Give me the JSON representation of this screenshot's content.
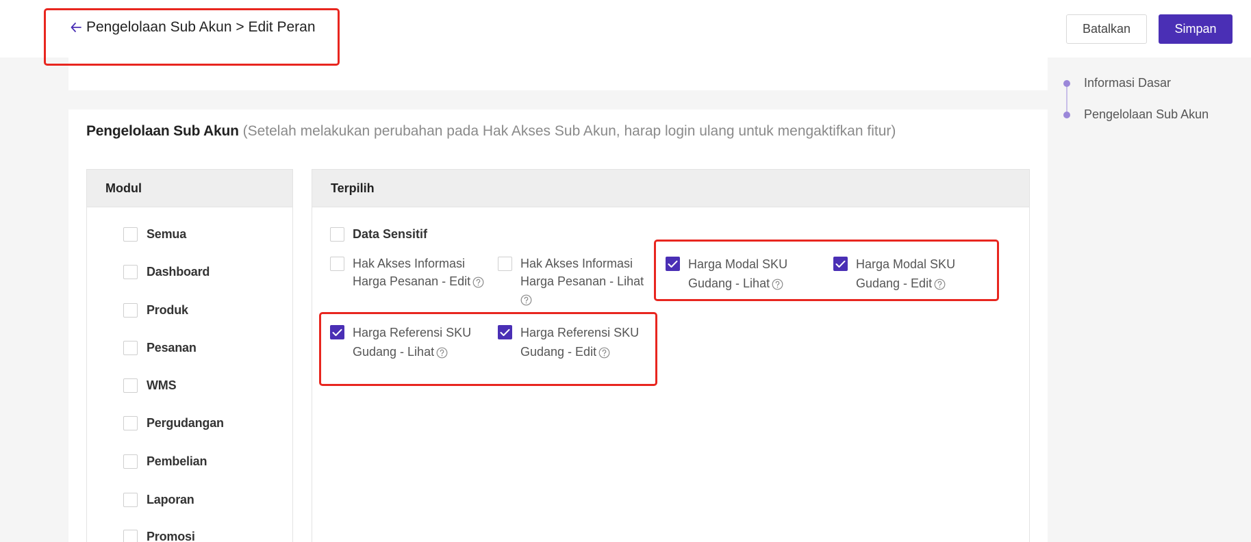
{
  "header": {
    "breadcrumb": "Pengelolaan Sub Akun > Edit Peran",
    "cancel_label": "Batalkan",
    "save_label": "Simpan",
    "accent_color": "#4a2fb5"
  },
  "section": {
    "title": "Pengelolaan Sub Akun",
    "note": " (Setelah melakukan perubahan pada Hak Akses Sub Akun, harap login ulang untuk mengaktifkan fitur)"
  },
  "modul_panel": {
    "header": "Modul",
    "items": [
      {
        "label": "Semua",
        "checked": false
      },
      {
        "label": "Dashboard",
        "checked": false
      },
      {
        "label": "Produk",
        "checked": false
      },
      {
        "label": "Pesanan",
        "checked": false
      },
      {
        "label": "WMS",
        "checked": false
      },
      {
        "label": "Pergudangan",
        "checked": false
      },
      {
        "label": "Pembelian",
        "checked": false
      },
      {
        "label": "Laporan",
        "checked": false
      },
      {
        "label": "Promosi",
        "checked": false
      }
    ]
  },
  "terpilih_panel": {
    "header": "Terpilih",
    "group_label": "Data Sensitif",
    "group_checked": false,
    "permissions": [
      {
        "line1": "Hak Akses Informasi",
        "line2": "Harga Pesanan - Edit",
        "checked": false,
        "icon": "help-icon"
      },
      {
        "line1": "Hak Akses Informasi",
        "line2": "Harga Pesanan - Lihat",
        "checked": false,
        "icon": "help-icon"
      },
      {
        "line1": "Harga Modal SKU",
        "line2": "Gudang - Lihat",
        "checked": true,
        "icon": "help-icon"
      },
      {
        "line1": "Harga Modal SKU",
        "line2": "Gudang - Edit",
        "checked": true,
        "icon": "help-icon"
      },
      {
        "line1": "Harga Referensi SKU",
        "line2": "Gudang - Lihat",
        "checked": true,
        "icon": "help-icon"
      },
      {
        "line1": "Harga Referensi SKU",
        "line2": "Gudang - Edit",
        "checked": true,
        "icon": "help-icon"
      }
    ]
  },
  "right_nav": {
    "items": [
      {
        "label": "Informasi Dasar"
      },
      {
        "label": "Pengelolaan Sub Akun"
      }
    ]
  }
}
